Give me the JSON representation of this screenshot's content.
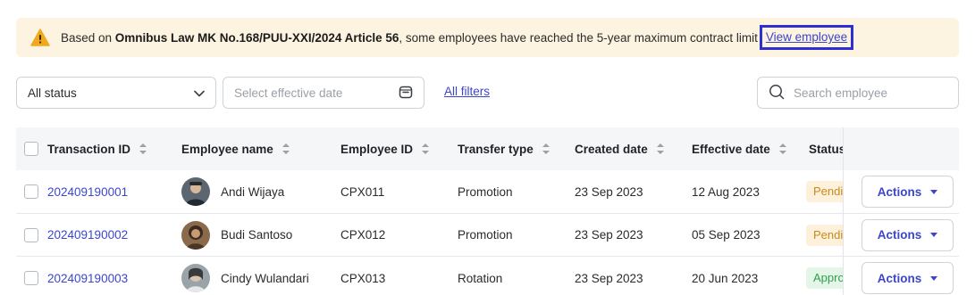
{
  "banner": {
    "prefix": "Based on ",
    "law": "Omnibus Law MK No.168/PUU-XXI/2024 Article 56",
    "suffix": ", some employees have reached the 5-year maximum contract limit",
    "link_label": "View employee",
    "icon": "warning-icon"
  },
  "filters": {
    "status_value": "All status",
    "date_placeholder": "Select effective date",
    "all_filters_label": "All filters",
    "search_placeholder": "Search employee"
  },
  "table": {
    "headers": {
      "transaction_id": "Transaction ID",
      "employee_name": "Employee name",
      "employee_id": "Employee ID",
      "transfer_type": "Transfer type",
      "created_date": "Created date",
      "effective_date": "Effective date",
      "status": "Status"
    },
    "rows": [
      {
        "transaction_id": "202409190001",
        "employee_name": "Andi Wijaya",
        "employee_id": "CPX011",
        "transfer_type": "Promotion",
        "created_date": "23 Sep 2023",
        "effective_date": "12 Aug 2023",
        "status": "Pending",
        "status_color": "#c98a1a",
        "action_label": "Actions"
      },
      {
        "transaction_id": "202409190002",
        "employee_name": "Budi Santoso",
        "employee_id": "CPX012",
        "transfer_type": "Promotion",
        "created_date": "23 Sep 2023",
        "effective_date": "05 Sep 2023",
        "status": "Pending",
        "status_color": "#c98a1a",
        "action_label": "Actions"
      },
      {
        "transaction_id": "202409190003",
        "employee_name": "Cindy Wulandari",
        "employee_id": "CPX013",
        "transfer_type": "Rotation",
        "created_date": "23 Sep 2023",
        "effective_date": "20 Jun 2023",
        "status": "Approved",
        "status_color": "#2f9e4f",
        "action_label": "Actions"
      }
    ]
  },
  "colors": {
    "accent": "#3b46c9",
    "banner_bg": "#fdf3e1",
    "highlight_border": "#2d2fd1"
  }
}
